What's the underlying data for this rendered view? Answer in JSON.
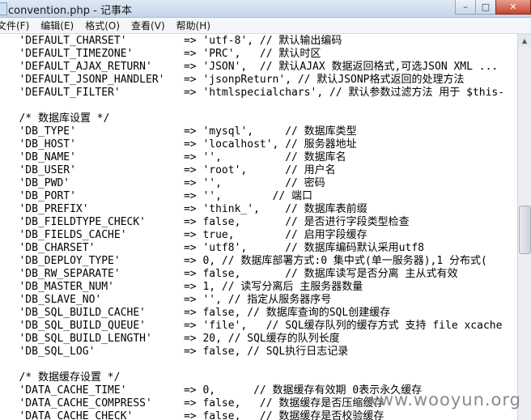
{
  "window": {
    "title": "convention.php - 记事本",
    "controls": {
      "minimize": "–",
      "maximize": "□",
      "close": "✕"
    }
  },
  "menu": [
    "文件(F)",
    "编辑(E)",
    "格式(O)",
    "查看(V)",
    "帮助(H)"
  ],
  "editor": {
    "lines": [
      "   'DEFAULT_CHARSET'         => 'utf-8', // 默认输出编码",
      "   'DEFAULT_TIMEZONE'        => 'PRC',   // 默认时区",
      "   'DEFAULT_AJAX_RETURN'     => 'JSON',  // 默认AJAX 数据返回格式,可选JSON XML ...",
      "   'DEFAULT_JSONP_HANDLER'   => 'jsonpReturn', // 默认JSONP格式返回的处理方法",
      "   'DEFAULT_FILTER'          => 'htmlspecialchars', // 默认参数过滤方法 用于 $this-",
      "",
      "   /* 数据库设置 */",
      "   'DB_TYPE'                 => 'mysql',     // 数据库类型",
      "   'DB_HOST'                 => 'localhost', // 服务器地址",
      "   'DB_NAME'                 => '',          // 数据库名",
      "   'DB_USER'                 => 'root',      // 用户名",
      "   'DB_PWD'                  => '',          // 密码",
      "   'DB_PORT'                 => '',        // 端口",
      "   'DB_PREFIX'               => 'think_',    // 数据库表前缀",
      "   'DB_FIELDTYPE_CHECK'      => false,       // 是否进行字段类型检查",
      "   'DB_FIELDS_CACHE'         => true,        // 启用字段缓存",
      "   'DB_CHARSET'              => 'utf8',      // 数据库编码默认采用utf8",
      "   'DB_DEPLOY_TYPE'          => 0, // 数据库部署方式:0 集中式(单一服务器),1 分布式(",
      "   'DB_RW_SEPARATE'          => false,       // 数据库读写是否分离 主从式有效",
      "   'DB_MASTER_NUM'           => 1, // 读写分离后 主服务器数量",
      "   'DB_SLAVE_NO'             => '', // 指定从服务器序号",
      "   'DB_SQL_BUILD_CACHE'      => false, // 数据库查询的SQL创建缓存",
      "   'DB_SQL_BUILD_QUEUE'      => 'file',   // SQL缓存队列的缓存方式 支持 file xcache",
      "   'DB_SQL_BUILD_LENGTH'     => 20, // SQL缓存的队列长度",
      "   'DB_SQL_LOG'              => false, // SQL执行日志记录",
      "",
      "   /* 数据缓存设置 */",
      "   'DATA_CACHE_TIME'         => 0,      // 数据缓存有效期 0表示永久缓存",
      "   'DATA_CACHE_COMPRESS'     => false,   // 数据缓存是否压缩缓存",
      "   'DATA_CACHE_CHECK'        => false,   // 数据缓存是否校验缓存"
    ]
  },
  "watermark": "www.wooyun.org"
}
